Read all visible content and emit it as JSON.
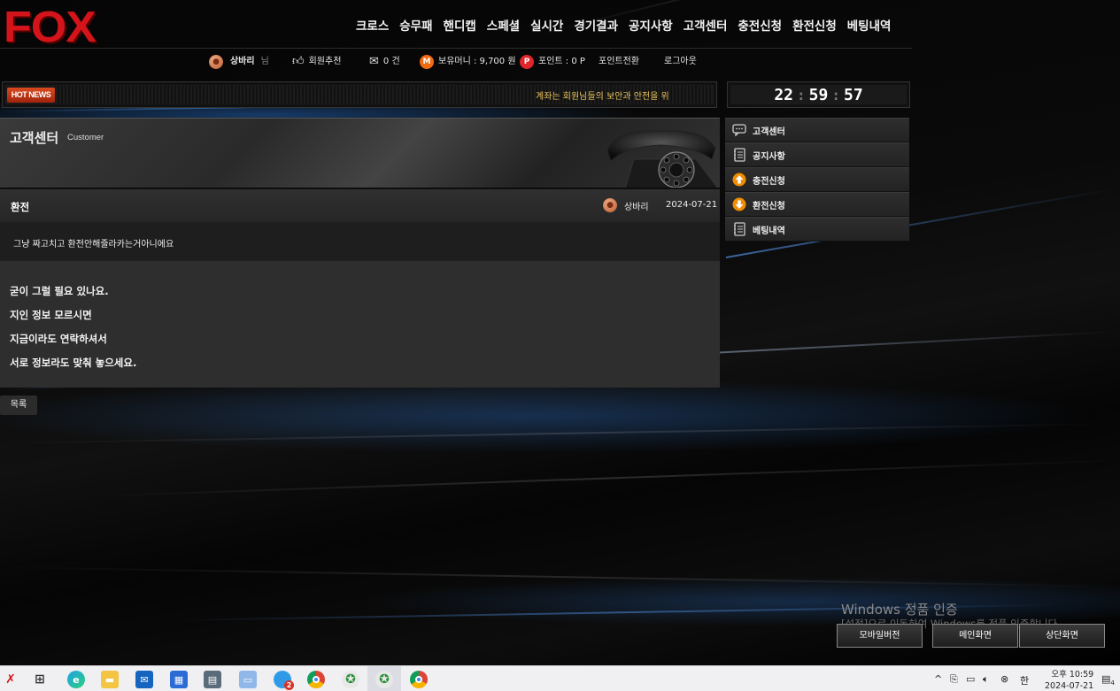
{
  "brand": {
    "logo": "FOX"
  },
  "topnav": [
    "크로스",
    "승무패",
    "핸디캡",
    "스페셜",
    "실시간",
    "경기결과",
    "공지사항",
    "고객센터",
    "충전신청",
    "환전신청",
    "베팅내역"
  ],
  "userbar": {
    "username": "상바리",
    "honorific": "님",
    "recommend": "회원추천",
    "messages": "0 건",
    "money": "보유머니 : 9,700 원",
    "points": "포인트 : 0 P",
    "point_exchange": "포인트전환",
    "logout": "로그아웃"
  },
  "news": {
    "badge": "HOT NEWS",
    "ticker": "계좌는 회원님들의 보안과 안전을 위"
  },
  "clock": {
    "h": "22",
    "m": "59",
    "s": "57"
  },
  "section": {
    "title": "고객센터",
    "subtitle": "Customer"
  },
  "post": {
    "title": "환전",
    "author": "상바리",
    "date": "2024-07-21",
    "body": "그냥 짜고치고 환전안해줄라카는거아니에요"
  },
  "reply": [
    "굳이 그럴 필요 있나요.",
    "지인 정보 모르시면",
    "지금이라도 연락하셔서",
    "서로 정보라도 맞춰 놓으세요."
  ],
  "list_button": "목록",
  "sidemenu": [
    {
      "label": "고객센터",
      "icon": "chat-icon"
    },
    {
      "label": "공지사항",
      "icon": "notebook-icon"
    },
    {
      "label": "충전신청",
      "icon": "arrow-up-icon"
    },
    {
      "label": "환전신청",
      "icon": "arrow-down-icon"
    },
    {
      "label": "베팅내역",
      "icon": "notebook-icon"
    }
  ],
  "bottom_buttons": [
    "모바일버전",
    "메인화면",
    "상단화면"
  ],
  "watermark": {
    "line1": "Windows 정품 인증",
    "line2": "[설정]으로 이동하여 Windows를 정품 인증합니다."
  },
  "taskbar": {
    "ime": "한",
    "time": "오후 10:59",
    "date": "2024-07-21",
    "notification_count": "4",
    "mail_badge": "2"
  },
  "colors": {
    "brand": "#d4141b",
    "accent_orange": "#f08c00",
    "ticker": "#e8c25a"
  }
}
